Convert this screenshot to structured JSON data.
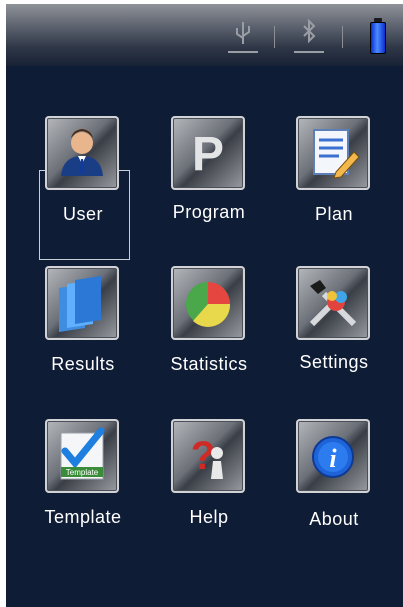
{
  "status_bar": {
    "icons": [
      "usb-icon",
      "bluetooth-icon",
      "battery-icon"
    ]
  },
  "menu": {
    "items": [
      {
        "label": "User",
        "icon": "user-icon",
        "selected": true
      },
      {
        "label": "Program",
        "icon": "program-icon"
      },
      {
        "label": "Plan",
        "icon": "plan-icon"
      },
      {
        "label": "Results",
        "icon": "results-icon"
      },
      {
        "label": "Statistics",
        "icon": "statistics-icon"
      },
      {
        "label": "Settings",
        "icon": "settings-icon"
      },
      {
        "label": "Template",
        "icon": "template-icon",
        "icon_text": "Template"
      },
      {
        "label": "Help",
        "icon": "help-icon"
      },
      {
        "label": "About",
        "icon": "about-icon"
      }
    ]
  },
  "colors": {
    "background": "#0f1c36",
    "label": "#ffffff",
    "battery": "#1f5cff"
  }
}
